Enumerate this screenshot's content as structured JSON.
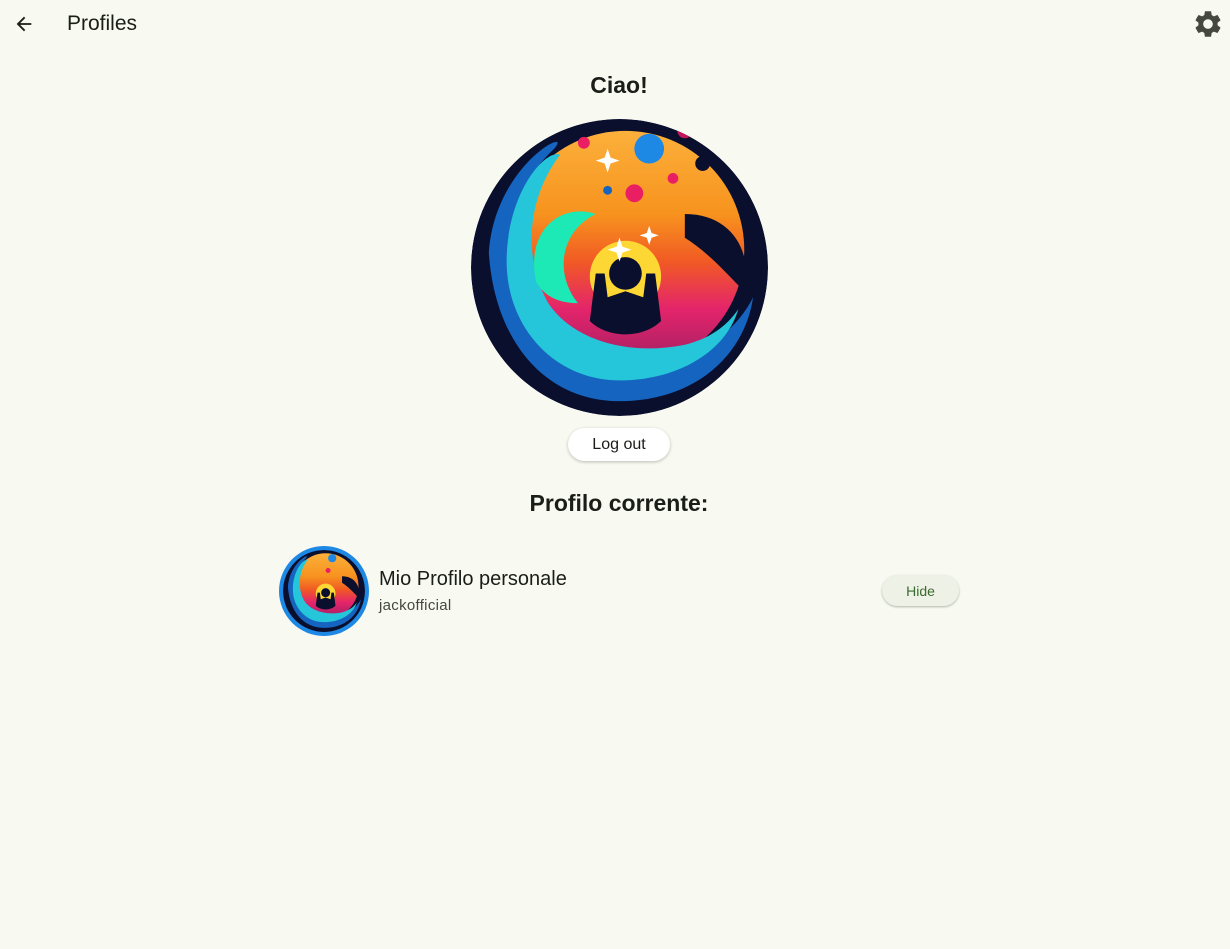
{
  "header": {
    "title": "Profiles",
    "back_icon": "arrow-back-icon",
    "settings_icon": "gear-icon"
  },
  "main": {
    "greeting": "Ciao!",
    "logout_label": "Log out",
    "current_profile_heading": "Profilo corrente:"
  },
  "current_profile": {
    "name": "Mio Profilo personale",
    "handle": "jackofficial",
    "hide_label": "Hide"
  },
  "colors": {
    "background": "#f8faf1",
    "accent_text": "#3a6a2e",
    "avatar_ring": "#1e88e5"
  }
}
